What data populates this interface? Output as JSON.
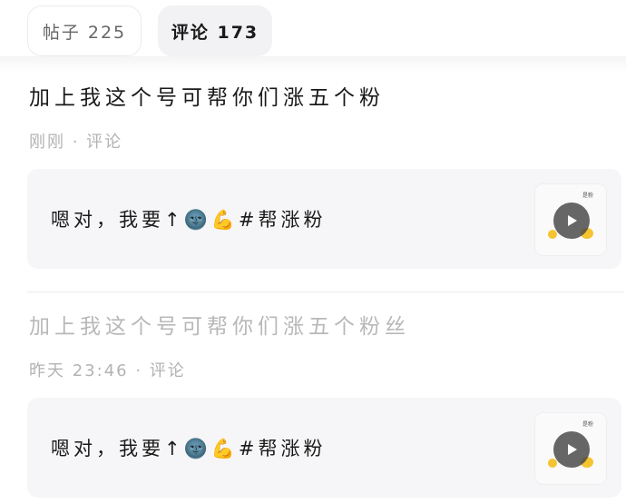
{
  "tabs": [
    {
      "label": "帖子 225",
      "active": false
    },
    {
      "label": "评论 173",
      "active": true
    }
  ],
  "items": [
    {
      "title": "加上我这个号可帮你们涨五个粉",
      "meta": "刚刚 · 评论",
      "quote": "嗯对，我要↑🌚💪#帮涨粉",
      "thumb_text": "是粉"
    },
    {
      "title": "加上我这个号可帮你们涨五个粉丝",
      "meta": "昨天 23:46 · 评论",
      "quote": "嗯对，我要↑🌚💪#帮涨粉",
      "thumb_text": "是粉"
    }
  ],
  "icons": {
    "play": "play-icon"
  },
  "colors": {
    "tab_active_bg": "#f2f2f4",
    "card_bg": "#f6f6f8",
    "meta_text": "#b3b3b3"
  }
}
